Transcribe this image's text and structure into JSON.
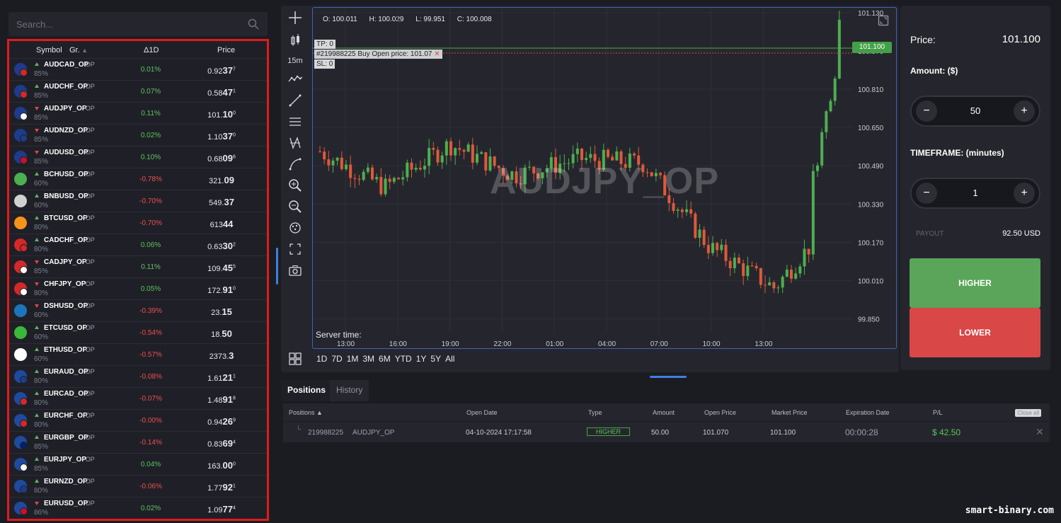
{
  "search": {
    "placeholder": "Search..."
  },
  "list": {
    "headers": {
      "symbol": "Symbol",
      "group": "Gr.",
      "delta": "Δ1D",
      "price": "Price"
    },
    "rows": [
      {
        "name": "AUDCAD_OP",
        "tag": "OP",
        "pct": "85%",
        "dir": "up",
        "chg": "0.01%",
        "sign": "pos",
        "price_a": "0.92",
        "price_b": "37",
        "price_c": "7",
        "flag": "#1e3c8c",
        "flag2": "#d62828"
      },
      {
        "name": "AUDCHF_OP",
        "tag": "OP",
        "pct": "85%",
        "dir": "up",
        "chg": "0.07%",
        "sign": "pos",
        "price_a": "0.58",
        "price_b": "47",
        "price_c": "1",
        "flag": "#1e3c8c",
        "flag2": "#d62828"
      },
      {
        "name": "AUDJPY_OP",
        "tag": "OP",
        "pct": "85%",
        "dir": "down",
        "chg": "0.11%",
        "sign": "pos",
        "price_a": "101.",
        "price_b": "10",
        "price_c": "0",
        "flag": "#1e3c8c",
        "flag2": "#ffffff"
      },
      {
        "name": "AUDNZD_OP",
        "tag": "OP",
        "pct": "85%",
        "dir": "down",
        "chg": "0.02%",
        "sign": "pos",
        "price_a": "1.10",
        "price_b": "37",
        "price_c": "0",
        "flag": "#1e3c8c",
        "flag2": "#1e3c8c"
      },
      {
        "name": "AUDUSD_OP",
        "tag": "OP",
        "pct": "85%",
        "dir": "down",
        "chg": "0.10%",
        "sign": "pos",
        "price_a": "0.68",
        "price_b": "09",
        "price_c": "6",
        "flag": "#1e3c8c",
        "flag2": "#c8102e"
      },
      {
        "name": "BCHUSD_OP",
        "tag": "OP",
        "pct": "60%",
        "dir": "up",
        "chg": "-0.78%",
        "sign": "neg",
        "price_a": "321.",
        "price_b": "09",
        "price_c": "",
        "flag": "#4caf50",
        "flag2": ""
      },
      {
        "name": "BNBUSD_OP",
        "tag": "OP",
        "pct": "60%",
        "dir": "up",
        "chg": "-0.70%",
        "sign": "neg",
        "price_a": "549.",
        "price_b": "37",
        "price_c": "",
        "flag": "#d0d0d0",
        "flag2": ""
      },
      {
        "name": "BTCUSD_OP",
        "tag": "OP",
        "pct": "80%",
        "dir": "up",
        "chg": "-0.70%",
        "sign": "neg",
        "price_a": "613",
        "price_b": "44",
        "price_c": "",
        "flag": "#f7931a",
        "flag2": ""
      },
      {
        "name": "CADCHF_OP",
        "tag": "OP",
        "pct": "80%",
        "dir": "up",
        "chg": "0.06%",
        "sign": "pos",
        "price_a": "0.63",
        "price_b": "30",
        "price_c": "2",
        "flag": "#d62828",
        "flag2": "#d62828"
      },
      {
        "name": "CADJPY_OP",
        "tag": "OP",
        "pct": "85%",
        "dir": "down",
        "chg": "0.11%",
        "sign": "pos",
        "price_a": "109.",
        "price_b": "45",
        "price_c": "5",
        "flag": "#d62828",
        "flag2": "#ffffff"
      },
      {
        "name": "CHFJPY_OP",
        "tag": "OP",
        "pct": "80%",
        "dir": "down",
        "chg": "0.05%",
        "sign": "pos",
        "price_a": "172.",
        "price_b": "91",
        "price_c": "0",
        "flag": "#d62828",
        "flag2": "#ffffff"
      },
      {
        "name": "DSHUSD_OP",
        "tag": "OP",
        "pct": "60%",
        "dir": "down",
        "chg": "-0.39%",
        "sign": "neg",
        "price_a": "23.",
        "price_b": "15",
        "price_c": "",
        "flag": "#1c75bc",
        "flag2": ""
      },
      {
        "name": "ETCUSD_OP",
        "tag": "OP",
        "pct": "60%",
        "dir": "up",
        "chg": "-0.54%",
        "sign": "neg",
        "price_a": "18.",
        "price_b": "50",
        "price_c": "",
        "flag": "#3ab83a",
        "flag2": ""
      },
      {
        "name": "ETHUSD_OP",
        "tag": "OP",
        "pct": "60%",
        "dir": "up",
        "chg": "-0.57%",
        "sign": "neg",
        "price_a": "2373.",
        "price_b": "3",
        "price_c": "",
        "flag": "#ffffff",
        "flag2": ""
      },
      {
        "name": "EURAUD_OP",
        "tag": "OP",
        "pct": "80%",
        "dir": "up",
        "chg": "-0.08%",
        "sign": "neg",
        "price_a": "1.61",
        "price_b": "21",
        "price_c": "1",
        "flag": "#1e4ba0",
        "flag2": "#1e3c8c"
      },
      {
        "name": "EURCAD_OP",
        "tag": "OP",
        "pct": "80%",
        "dir": "up",
        "chg": "-0.07%",
        "sign": "neg",
        "price_a": "1.48",
        "price_b": "91",
        "price_c": "8",
        "flag": "#1e4ba0",
        "flag2": "#d62828"
      },
      {
        "name": "EURCHF_OP",
        "tag": "OP",
        "pct": "80%",
        "dir": "up",
        "chg": "-0.00%",
        "sign": "neg",
        "price_a": "0.94",
        "price_b": "26",
        "price_c": "9",
        "flag": "#1e4ba0",
        "flag2": "#d62828"
      },
      {
        "name": "EURGBP_OP",
        "tag": "OP",
        "pct": "85%",
        "dir": "up",
        "chg": "-0.14%",
        "sign": "neg",
        "price_a": "0.83",
        "price_b": "69",
        "price_c": "4",
        "flag": "#1e4ba0",
        "flag2": "#012169"
      },
      {
        "name": "EURJPY_OP",
        "tag": "OP",
        "pct": "85%",
        "dir": "up",
        "chg": "0.04%",
        "sign": "pos",
        "price_a": "163.",
        "price_b": "00",
        "price_c": "0",
        "flag": "#1e4ba0",
        "flag2": "#ffffff"
      },
      {
        "name": "EURNZD_OP",
        "tag": "OP",
        "pct": "80%",
        "dir": "up",
        "chg": "-0.06%",
        "sign": "neg",
        "price_a": "1.77",
        "price_b": "92",
        "price_c": "1",
        "flag": "#1e4ba0",
        "flag2": "#1e3c8c"
      },
      {
        "name": "EURUSD_OP",
        "tag": "OP",
        "pct": "86%",
        "dir": "down",
        "chg": "0.02%",
        "sign": "pos",
        "price_a": "1.09",
        "price_b": "77",
        "price_c": "4",
        "flag": "#1e4ba0",
        "flag2": "#c8102e"
      }
    ]
  },
  "toolbar": {
    "timeframe": "15m"
  },
  "chart": {
    "ohlc": {
      "o": "O: 100.011",
      "h": "H: 100.029",
      "l": "L: 99.951",
      "c": "C: 100.008"
    },
    "watermark": "AUDJPY_OP",
    "server_time": "Server time:",
    "tp": "TP: 0",
    "order": "#219988225  Buy  Open price: 101.07",
    "sl": "SL: 0",
    "current_price": "101.100",
    "top_tick": "101.130",
    "y_ticks": [
      "100.970",
      "100.810",
      "100.650",
      "100.490",
      "100.330",
      "100.170",
      "100.010",
      "99.850"
    ],
    "x_ticks": [
      "13:00",
      "16:00",
      "19:00",
      "22:00",
      "01:00",
      "04:00",
      "07:00",
      "10:00",
      "13:00"
    ],
    "ranges": [
      "1D",
      "7D",
      "1M",
      "3M",
      "6M",
      "YTD",
      "1Y",
      "5Y",
      "All"
    ]
  },
  "chart_data": {
    "type": "line",
    "title": "AUDJPY_OP",
    "xlabel": "",
    "ylabel": "",
    "ylim": [
      99.79,
      101.15
    ],
    "x": [
      "13:00",
      "16:00",
      "19:00",
      "22:00",
      "01:00",
      "04:00",
      "07:00",
      "10:00",
      "13:00"
    ],
    "series": [
      {
        "name": "AUDJPY_OP",
        "values": [
          100.55,
          100.4,
          100.58,
          100.45,
          100.52,
          100.5,
          100.15,
          99.98,
          100.3
        ]
      }
    ]
  },
  "trade": {
    "price_label": "Price:",
    "price_value": "101.100",
    "amount_label": "Amount: ($)",
    "amount": "50",
    "timeframe_label": "TIMEFRAME: (minutes)",
    "timeframe": "1",
    "minus": "−",
    "plus": "+",
    "payout_label": "PAYOUT",
    "payout_value": "92.50 USD",
    "higher": "HIGHER",
    "lower": "LOWER"
  },
  "positions": {
    "tab_positions": "Positions",
    "tab_history": "History",
    "headers": {
      "positions": "Positions ▲",
      "open_date": "Open Date",
      "type": "Type",
      "amount": "Amount",
      "open_price": "Open Price",
      "market_price": "Market Price",
      "expiration": "Expiration Date",
      "pl": "P/L",
      "close_all": "Close all"
    },
    "row": {
      "id": "219988225",
      "symbol": "AUDJPY_OP",
      "open_date": "04-10-2024 17:17:58",
      "type": "HIGHER",
      "amount": "50.00",
      "open_price": "101.070",
      "market_price": "101.100",
      "expiration": "00:00:28",
      "pl": "$ 42.50",
      "close": "✕"
    }
  },
  "site": "smart-binary.com"
}
